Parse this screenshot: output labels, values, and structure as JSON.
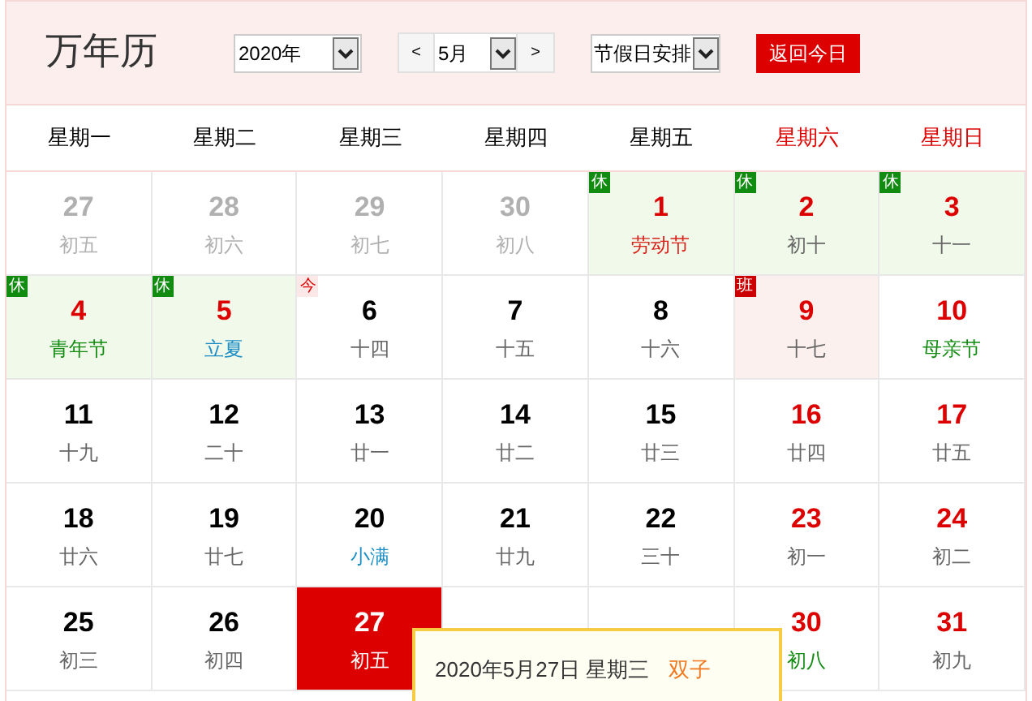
{
  "title": "万年历",
  "year_select": {
    "value": "2020年"
  },
  "month_select": {
    "prev": "<",
    "value": "5月",
    "next": ">"
  },
  "holiday_select": {
    "value": "节假日安排"
  },
  "today_button": "返回今日",
  "weekdays": [
    {
      "label": "星期一",
      "weekend": false
    },
    {
      "label": "星期二",
      "weekend": false
    },
    {
      "label": "星期三",
      "weekend": false
    },
    {
      "label": "星期四",
      "weekend": false
    },
    {
      "label": "星期五",
      "weekend": false
    },
    {
      "label": "星期六",
      "weekend": true
    },
    {
      "label": "星期日",
      "weekend": true
    }
  ],
  "days": [
    {
      "day": "27",
      "lunar": {
        "text": "初五",
        "kind": "plain"
      },
      "kind": "other"
    },
    {
      "day": "28",
      "lunar": {
        "text": "初六",
        "kind": "plain"
      },
      "kind": "other"
    },
    {
      "day": "29",
      "lunar": {
        "text": "初七",
        "kind": "plain"
      },
      "kind": "other"
    },
    {
      "day": "30",
      "lunar": {
        "text": "初八",
        "kind": "plain"
      },
      "kind": "other"
    },
    {
      "day": "1",
      "lunar": {
        "text": "劳动节",
        "kind": "holiday"
      },
      "kind": "rest",
      "badge": "休",
      "red": true
    },
    {
      "day": "2",
      "lunar": {
        "text": "初十",
        "kind": "plain"
      },
      "kind": "rest",
      "badge": "休",
      "red": true
    },
    {
      "day": "3",
      "lunar": {
        "text": "十一",
        "kind": "plain"
      },
      "kind": "rest",
      "badge": "休",
      "red": true
    },
    {
      "day": "4",
      "lunar": {
        "text": "青年节",
        "kind": "festival"
      },
      "kind": "rest",
      "badge": "休",
      "red": true
    },
    {
      "day": "5",
      "lunar": {
        "text": "立夏",
        "kind": "term"
      },
      "kind": "rest",
      "badge": "休",
      "red": true
    },
    {
      "day": "6",
      "lunar": {
        "text": "十四",
        "kind": "plain"
      },
      "kind": "normal",
      "badge": "今",
      "red": false
    },
    {
      "day": "7",
      "lunar": {
        "text": "十五",
        "kind": "plain"
      },
      "kind": "normal",
      "red": false
    },
    {
      "day": "8",
      "lunar": {
        "text": "十六",
        "kind": "plain"
      },
      "kind": "normal",
      "red": false
    },
    {
      "day": "9",
      "lunar": {
        "text": "十七",
        "kind": "plain"
      },
      "kind": "work",
      "badge": "班",
      "red": true
    },
    {
      "day": "10",
      "lunar": {
        "text": "母亲节",
        "kind": "festival"
      },
      "kind": "normal",
      "red": true
    },
    {
      "day": "11",
      "lunar": {
        "text": "十九",
        "kind": "plain"
      },
      "kind": "normal",
      "red": false
    },
    {
      "day": "12",
      "lunar": {
        "text": "二十",
        "kind": "plain"
      },
      "kind": "normal",
      "red": false
    },
    {
      "day": "13",
      "lunar": {
        "text": "廿一",
        "kind": "plain"
      },
      "kind": "normal",
      "red": false
    },
    {
      "day": "14",
      "lunar": {
        "text": "廿二",
        "kind": "plain"
      },
      "kind": "normal",
      "red": false
    },
    {
      "day": "15",
      "lunar": {
        "text": "廿三",
        "kind": "plain"
      },
      "kind": "normal",
      "red": false
    },
    {
      "day": "16",
      "lunar": {
        "text": "廿四",
        "kind": "plain"
      },
      "kind": "normal",
      "red": true
    },
    {
      "day": "17",
      "lunar": {
        "text": "廿五",
        "kind": "plain"
      },
      "kind": "normal",
      "red": true
    },
    {
      "day": "18",
      "lunar": {
        "text": "廿六",
        "kind": "plain"
      },
      "kind": "normal",
      "red": false
    },
    {
      "day": "19",
      "lunar": {
        "text": "廿七",
        "kind": "plain"
      },
      "kind": "normal",
      "red": false
    },
    {
      "day": "20",
      "lunar": {
        "text": "小满",
        "kind": "term"
      },
      "kind": "normal",
      "red": false
    },
    {
      "day": "21",
      "lunar": {
        "text": "廿九",
        "kind": "plain"
      },
      "kind": "normal",
      "red": false
    },
    {
      "day": "22",
      "lunar": {
        "text": "三十",
        "kind": "plain"
      },
      "kind": "normal",
      "red": false
    },
    {
      "day": "23",
      "lunar": {
        "text": "初一",
        "kind": "plain"
      },
      "kind": "normal",
      "red": true
    },
    {
      "day": "24",
      "lunar": {
        "text": "初二",
        "kind": "plain"
      },
      "kind": "normal",
      "red": true
    },
    {
      "day": "25",
      "lunar": {
        "text": "初三",
        "kind": "plain"
      },
      "kind": "normal",
      "red": false
    },
    {
      "day": "26",
      "lunar": {
        "text": "初四",
        "kind": "plain"
      },
      "kind": "normal",
      "red": false
    },
    {
      "day": "27",
      "lunar": {
        "text": "初五",
        "kind": "plain"
      },
      "kind": "today"
    },
    {
      "kind": "normal"
    },
    {
      "kind": "normal"
    },
    {
      "day": "30",
      "lunar": {
        "text": "初八",
        "kind": "festival"
      },
      "kind": "normal",
      "red": true
    },
    {
      "day": "31",
      "lunar": {
        "text": "初九",
        "kind": "plain"
      },
      "kind": "normal",
      "red": true
    }
  ],
  "tooltip": {
    "date": "2020年5月27日 星期三",
    "sign": "双子"
  }
}
